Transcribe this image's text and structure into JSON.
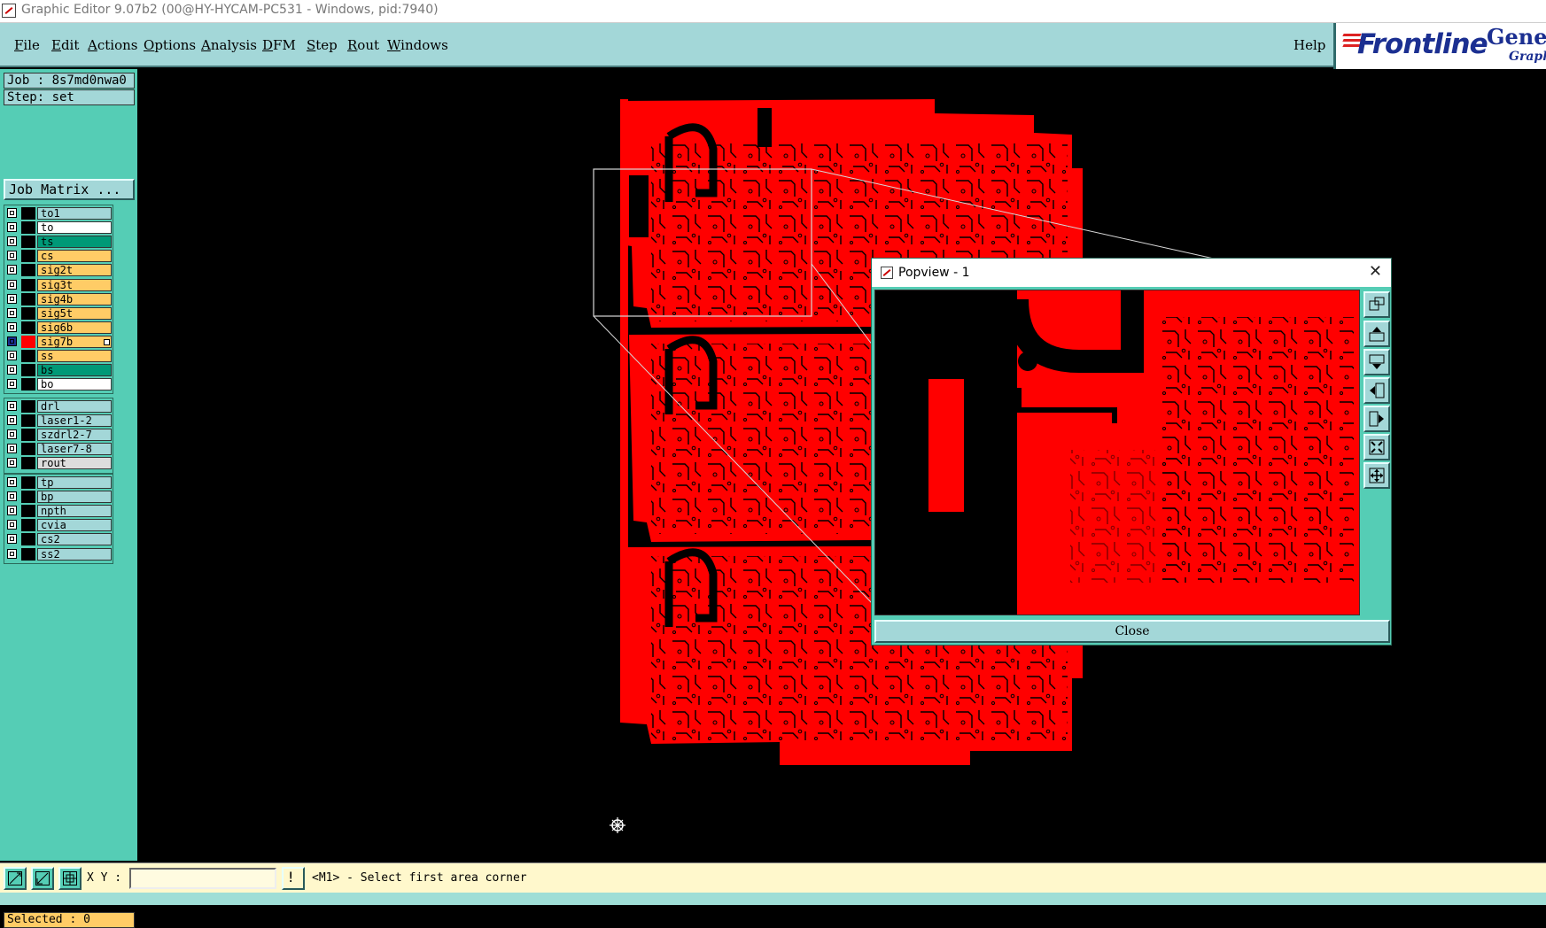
{
  "window": {
    "title": "Graphic Editor 9.07b2 (00@HY-HYCAM-PC531 - Windows, pid:7940)"
  },
  "menu": [
    {
      "label": "File",
      "u": "F",
      "rest": "ile"
    },
    {
      "label": "Edit",
      "u": "E",
      "rest": "dit"
    },
    {
      "label": "Actions",
      "u": "A",
      "rest": "ctions"
    },
    {
      "label": "Options",
      "u": "O",
      "rest": "ptions"
    },
    {
      "label": "Analysis",
      "u": "A",
      "rest": "nalysis"
    },
    {
      "label": "DFM",
      "u": "D",
      "rest": "FM"
    },
    {
      "label": "Step",
      "u": "S",
      "rest": "tep"
    },
    {
      "label": "Rout",
      "u": "R",
      "rest": "out"
    },
    {
      "label": "Windows",
      "u": "W",
      "rest": "indows"
    }
  ],
  "help_label": "Help",
  "logo": {
    "brand": "Frontline",
    "product": "Genesi",
    "sub": "Graphic"
  },
  "job": {
    "job_label": "Job : 8s7md0nwa0",
    "step_label": "Step: set",
    "matrix_button": "Job Matrix ..."
  },
  "colors": {
    "signal": "#ffcc66",
    "mask": "#009977",
    "board": "#ffffff",
    "drill": "#a3d7d8",
    "rout": "#dddddd",
    "active": "#ff0000",
    "copper": "#ff0000"
  },
  "layer_groups": [
    {
      "layers": [
        {
          "name": "to1",
          "color": "#a3d7d8"
        },
        {
          "name": "to",
          "color": "#ffffff"
        },
        {
          "name": "ts",
          "color": "#009977"
        },
        {
          "name": "cs",
          "color": "#ffcc66"
        },
        {
          "name": "sig2t",
          "color": "#ffcc66"
        },
        {
          "name": "sig3t",
          "color": "#ffcc66"
        },
        {
          "name": "sig4b",
          "color": "#ffcc66"
        },
        {
          "name": "sig5t",
          "color": "#ffcc66"
        },
        {
          "name": "sig6b",
          "color": "#ffcc66"
        },
        {
          "name": "sig7b",
          "color": "#ffcc66",
          "active": true
        },
        {
          "name": "ss",
          "color": "#ffcc66"
        },
        {
          "name": "bs",
          "color": "#009977"
        },
        {
          "name": "bo",
          "color": "#ffffff"
        }
      ]
    },
    {
      "layers": [
        {
          "name": "drl",
          "color": "#a3d7d8"
        },
        {
          "name": "laser1-2",
          "color": "#a3d7d8"
        },
        {
          "name": "szdrl2-7",
          "color": "#a3d7d8"
        },
        {
          "name": "laser7-8",
          "color": "#a3d7d8"
        },
        {
          "name": "rout",
          "color": "#dddddd"
        }
      ]
    },
    {
      "layers": [
        {
          "name": "tp",
          "color": "#a3d7d8"
        },
        {
          "name": "bp",
          "color": "#a3d7d8"
        },
        {
          "name": "npth",
          "color": "#a3d7d8"
        },
        {
          "name": "cvia",
          "color": "#a3d7d8"
        },
        {
          "name": "cs2",
          "color": "#a3d7d8"
        },
        {
          "name": "ss2",
          "color": "#a3d7d8"
        }
      ]
    }
  ],
  "selected_label": "Selected : 0",
  "status": {
    "xy_label": "X Y :",
    "xy_value": "",
    "message": "<M1> - Select first area corner",
    "warn_glyph": "!"
  },
  "popview": {
    "title": "Popview - 1",
    "close_label": "Close",
    "close_glyph": "✕"
  },
  "icons": {
    "menu_cursor": "crosshair-cursor-icon"
  }
}
